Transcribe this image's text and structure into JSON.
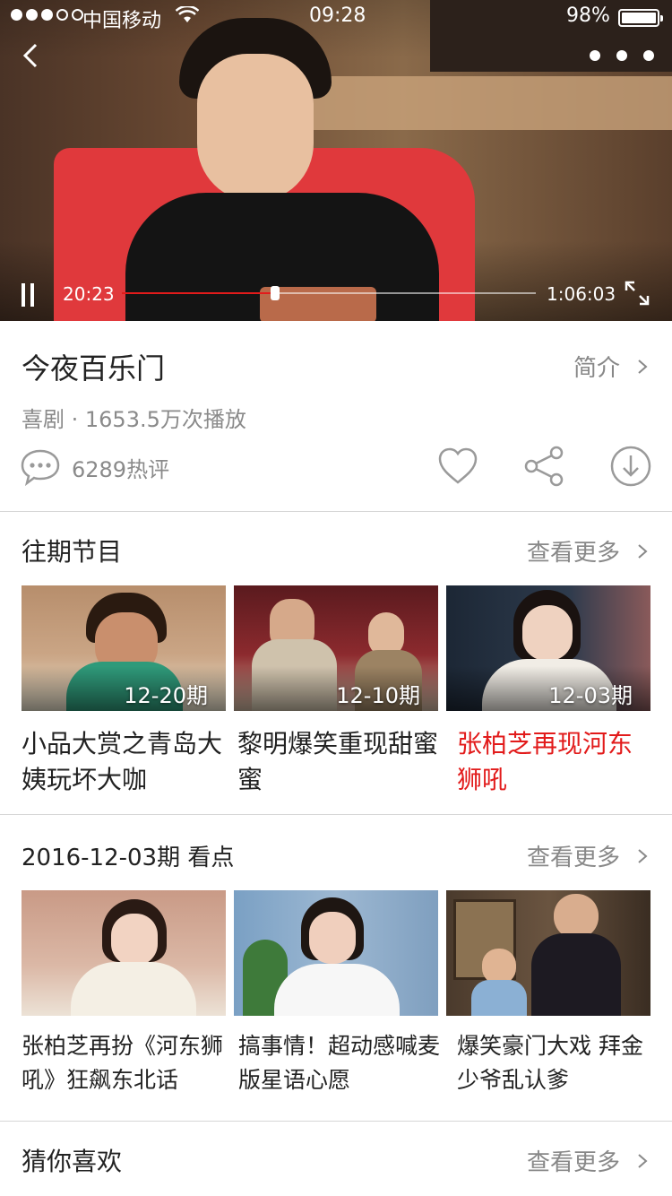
{
  "status_bar": {
    "carrier": "中国移动",
    "time": "09:28",
    "battery": "98%"
  },
  "player": {
    "current_time": "20:23",
    "total_time": "1:06:03",
    "progress": 0.37,
    "accent": "#e21b1b"
  },
  "show": {
    "title": "今夜百乐门",
    "intro_label": "简介",
    "meta": "喜剧 · 1653.5万次播放",
    "comments": "6289热评"
  },
  "past_episodes": {
    "title": "往期节目",
    "more": "查看更多",
    "items": [
      {
        "date": "12-20期",
        "caption": "小品大赏之青岛大姨玩坏大咖"
      },
      {
        "date": "12-10期",
        "caption": "黎明爆笑重现甜蜜蜜"
      },
      {
        "date": "12-03期",
        "caption": "张柏芝再现河东狮吼",
        "active": true
      }
    ]
  },
  "highlights": {
    "title": "2016-12-03期 看点",
    "more": "查看更多",
    "items": [
      {
        "caption": "张柏芝再扮《河东狮吼》狂飙东北话"
      },
      {
        "caption": "搞事情！超动感喊麦版星语心愿"
      },
      {
        "caption": "爆笑豪门大戏 拜金少爷乱认爹"
      }
    ]
  },
  "recommend": {
    "title": "猜你喜欢",
    "more": "查看更多"
  },
  "icons": {
    "back": "chevron-left-icon",
    "more": "more-dots-icon",
    "pause": "pause-icon",
    "fullscreen": "fullscreen-icon",
    "comment": "comment-bubble-icon",
    "like": "heart-icon",
    "share": "share-icon",
    "download": "download-icon",
    "chevron": "chevron-right-icon"
  }
}
